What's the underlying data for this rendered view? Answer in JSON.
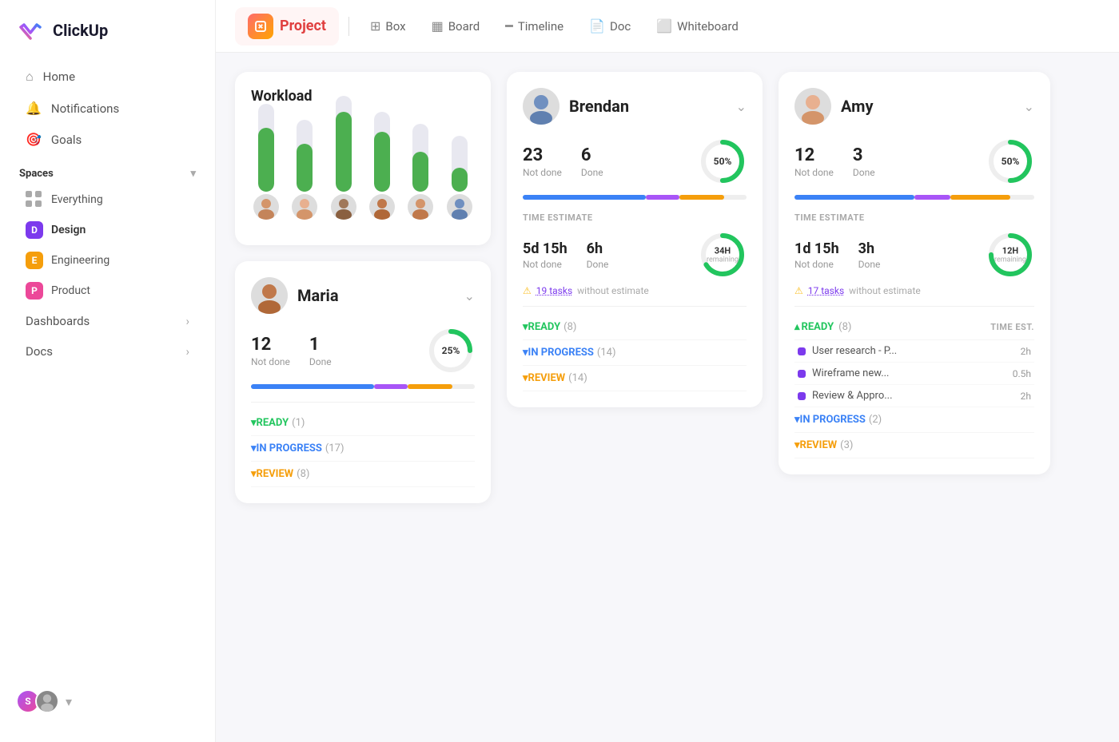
{
  "app": {
    "name": "ClickUp"
  },
  "topnav": {
    "project_label": "Project",
    "tabs": [
      {
        "id": "box",
        "label": "Box",
        "icon": "⊞"
      },
      {
        "id": "board",
        "label": "Board",
        "icon": "▦"
      },
      {
        "id": "timeline",
        "label": "Timeline",
        "icon": "━"
      },
      {
        "id": "doc",
        "label": "Doc",
        "icon": "📄"
      },
      {
        "id": "whiteboard",
        "label": "Whiteboard",
        "icon": "⬜"
      }
    ]
  },
  "sidebar": {
    "nav": [
      {
        "id": "home",
        "label": "Home",
        "icon": "⌂"
      },
      {
        "id": "notifications",
        "label": "Notifications",
        "icon": "🔔"
      },
      {
        "id": "goals",
        "label": "Goals",
        "icon": "🎯"
      }
    ],
    "spaces_label": "Spaces",
    "spaces": [
      {
        "id": "everything",
        "label": "Everything",
        "prefix": "0",
        "color": ""
      },
      {
        "id": "design",
        "label": "Design",
        "letter": "D",
        "color": "#7c3aed"
      },
      {
        "id": "engineering",
        "label": "Engineering",
        "letter": "E",
        "color": "#f59e0b"
      },
      {
        "id": "product",
        "label": "Product",
        "letter": "P",
        "color": "#ec4899"
      }
    ],
    "expandable": [
      {
        "id": "dashboards",
        "label": "Dashboards"
      },
      {
        "id": "docs",
        "label": "Docs"
      }
    ]
  },
  "workload": {
    "title": "Workload",
    "bars": [
      {
        "total_h": 110,
        "fill_h": 80
      },
      {
        "total_h": 90,
        "fill_h": 60
      },
      {
        "total_h": 120,
        "fill_h": 100
      },
      {
        "total_h": 100,
        "fill_h": 75
      },
      {
        "total_h": 85,
        "fill_h": 50
      },
      {
        "total_h": 70,
        "fill_h": 30
      }
    ]
  },
  "brendan": {
    "name": "Brendan",
    "not_done": 23,
    "done": 6,
    "percent": 50,
    "percent_label": "50%",
    "time_estimate_label": "TIME ESTIMATE",
    "not_done_time": "5d 15h",
    "done_time": "6h",
    "remaining_label": "34H",
    "remaining_sub": "remaining",
    "warning_text": "19 tasks",
    "warning_suffix": " without estimate",
    "statuses": [
      {
        "id": "ready",
        "label": "READY",
        "count": 8,
        "color": "#22c55e"
      },
      {
        "id": "in_progress",
        "label": "IN PROGRESS",
        "count": 14,
        "color": "#3b82f6"
      },
      {
        "id": "review",
        "label": "REVIEW",
        "count": 14,
        "color": "#f59e0b"
      }
    ]
  },
  "amy": {
    "name": "Amy",
    "not_done": 12,
    "done": 3,
    "percent": 50,
    "percent_label": "50%",
    "time_estimate_label": "TIME ESTIMATE",
    "not_done_time": "1d 15h",
    "done_time": "3h",
    "remaining_label": "12H",
    "remaining_sub": "remaining",
    "warning_text": "17 tasks",
    "warning_suffix": " without estimate",
    "time_est_col": "TIME EST.",
    "statuses": [
      {
        "id": "ready",
        "label": "READY",
        "count": 8,
        "color": "#22c55e"
      },
      {
        "id": "in_progress",
        "label": "IN PROGRESS",
        "count": 2,
        "color": "#3b82f6"
      },
      {
        "id": "review",
        "label": "REVIEW",
        "count": 3,
        "color": "#f59e0b"
      }
    ],
    "tasks": [
      {
        "name": "User research - P...",
        "time": "2h"
      },
      {
        "name": "Wireframe new...",
        "time": "0.5h"
      },
      {
        "name": "Review & Appro...",
        "time": "2h"
      }
    ]
  },
  "maria": {
    "name": "Maria",
    "not_done": 12,
    "done": 1,
    "percent": 25,
    "percent_label": "25%",
    "statuses": [
      {
        "id": "ready",
        "label": "READY",
        "count": 1,
        "color": "#22c55e"
      },
      {
        "id": "in_progress",
        "label": "IN PROGRESS",
        "count": 17,
        "color": "#3b82f6"
      },
      {
        "id": "review",
        "label": "REVIEW",
        "count": 8,
        "color": "#f59e0b"
      }
    ]
  }
}
